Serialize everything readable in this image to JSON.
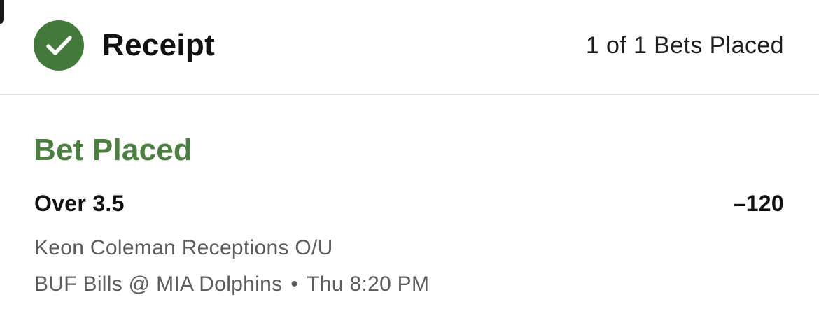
{
  "header": {
    "title": "Receipt",
    "bets_summary": "1 of 1 Bets Placed",
    "status_icon": "checkmark-circle-icon",
    "status_color": "#437a3c"
  },
  "bet": {
    "status": "Bet Placed",
    "status_color": "#4a7f3f",
    "selection": "Over 3.5",
    "odds": "–120",
    "market": "Keon Coleman Receptions O/U",
    "event": {
      "matchup": "BUF Bills @ MIA Dolphins",
      "separator": "•",
      "time": "Thu 8:20 PM"
    }
  }
}
